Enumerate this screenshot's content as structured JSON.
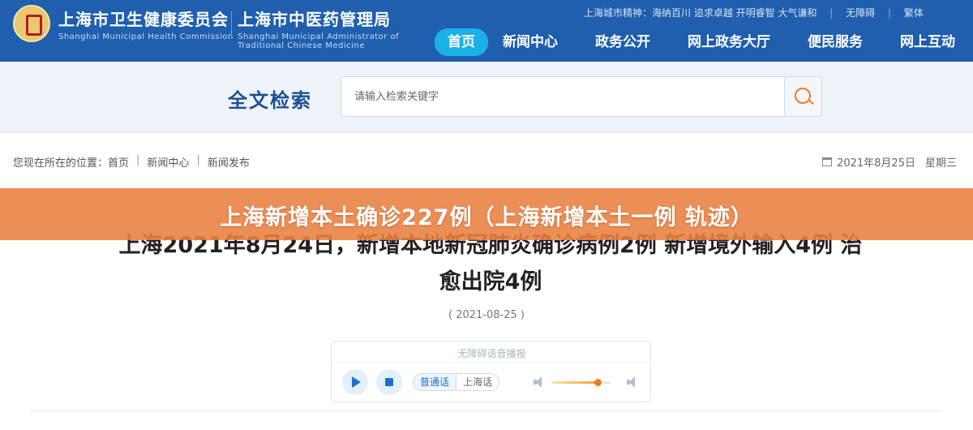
{
  "header": {
    "org1_name": "上海市卫生健康委员会",
    "org1_en": "Shanghai Municipal Health Commission",
    "org2_name": "上海市中医药管理局",
    "org2_en": "Shanghai Municipal Administrator of Traditional Chinese Medicine",
    "top_links": {
      "spirit": "上海城市精神：海纳百川 追求卓越 开明睿智 大气谦和",
      "accessible": "无障碍",
      "traditional": "繁体"
    },
    "nav": [
      "首页",
      "新闻中心",
      "政务公开",
      "网上政务大厅",
      "便民服务",
      "网上互动"
    ]
  },
  "search": {
    "title": "全文检索",
    "placeholder": "请输入检索关键字"
  },
  "breadcrumb": {
    "prefix": "您现在所在的位置：",
    "items": [
      "首页",
      "新闻中心",
      "新闻发布"
    ]
  },
  "date_info": {
    "date": "2021年8月25日",
    "weekday": "星期三"
  },
  "overlay_title": "上海新增本土确诊227例（上海新增本土一例 轨迹）",
  "article": {
    "title": "上海2021年8月24日，新增本地新冠肺炎确诊病例2例 新增境外输入4例 治愈出院4例",
    "date": "( 2021-08-25 )"
  },
  "player": {
    "title": "无障碍语音播报",
    "lang_options": [
      "普通话",
      "上海话"
    ],
    "volume": 0.78
  },
  "colors": {
    "header_bg": "#1f5fae",
    "nav_active": "#1ab1e6",
    "overlay": "#e88040",
    "accent_orange": "#e87b26"
  }
}
